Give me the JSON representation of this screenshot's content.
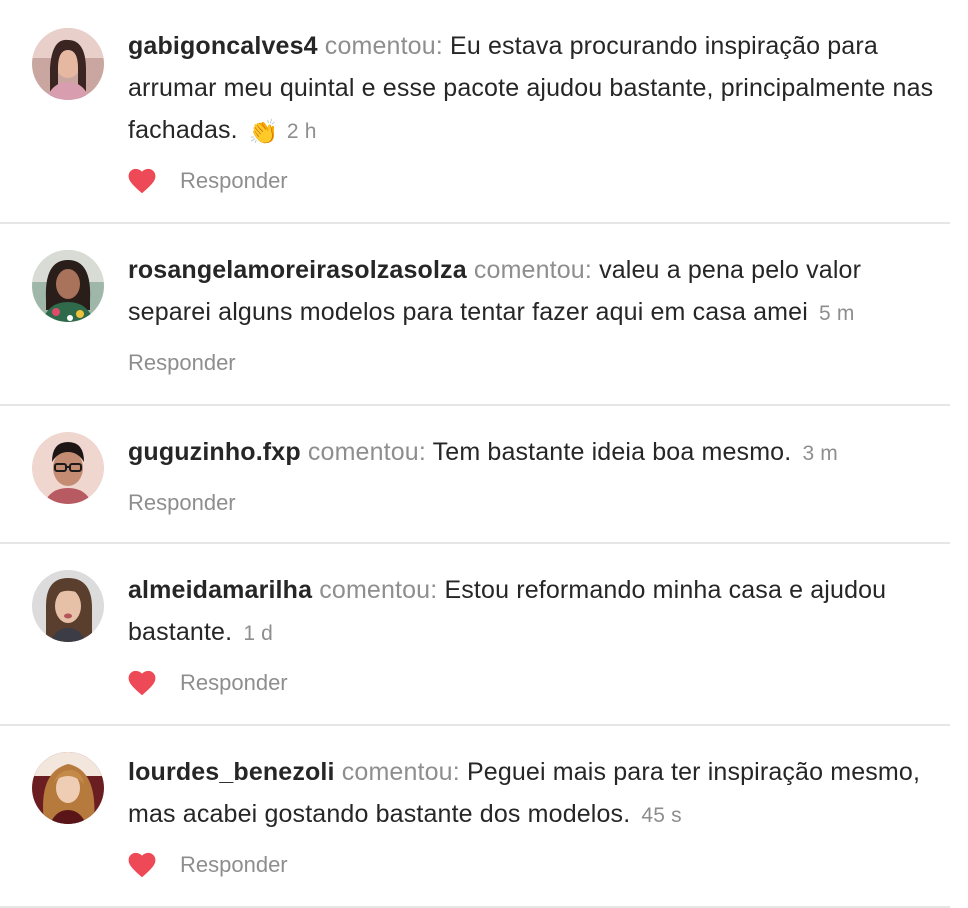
{
  "comments": [
    {
      "username": "gabigoncalves4",
      "verb": "comentou:",
      "message": "Eu estava procurando inspiração para arrumar meu quintal e esse pacote ajudou bastante, principalmente nas fachadas.",
      "emoji": "👏",
      "time": "2 h",
      "liked": true,
      "reply_label": "Responder"
    },
    {
      "username": "rosangelamoreirasolzasolza",
      "verb": "comentou:",
      "message": "valeu a pena pelo valor separei alguns modelos para tentar fazer aqui em casa amei",
      "time": "5 m",
      "liked": false,
      "reply_label": "Responder"
    },
    {
      "username": "guguzinho.fxp",
      "verb": "comentou:",
      "message": "Tem bastante ideia boa mesmo.",
      "time": "3 m",
      "liked": false,
      "reply_label": "Responder"
    },
    {
      "username": "almeidamarilha",
      "verb": "comentou:",
      "message": "Estou reformando minha casa e ajudou bastante.",
      "time": "1 d",
      "liked": true,
      "reply_label": "Responder"
    },
    {
      "username": "lourdes_benezoli",
      "verb": "comentou:",
      "message": "Peguei mais para ter inspiração mesmo, mas acabei gostando bastante dos modelos.",
      "time": "45 s",
      "liked": true,
      "reply_label": "Responder"
    }
  ],
  "colors": {
    "heart": "#ed4956",
    "muted": "#8e8e8e",
    "text": "#262626",
    "divider": "#e6e6e6"
  }
}
